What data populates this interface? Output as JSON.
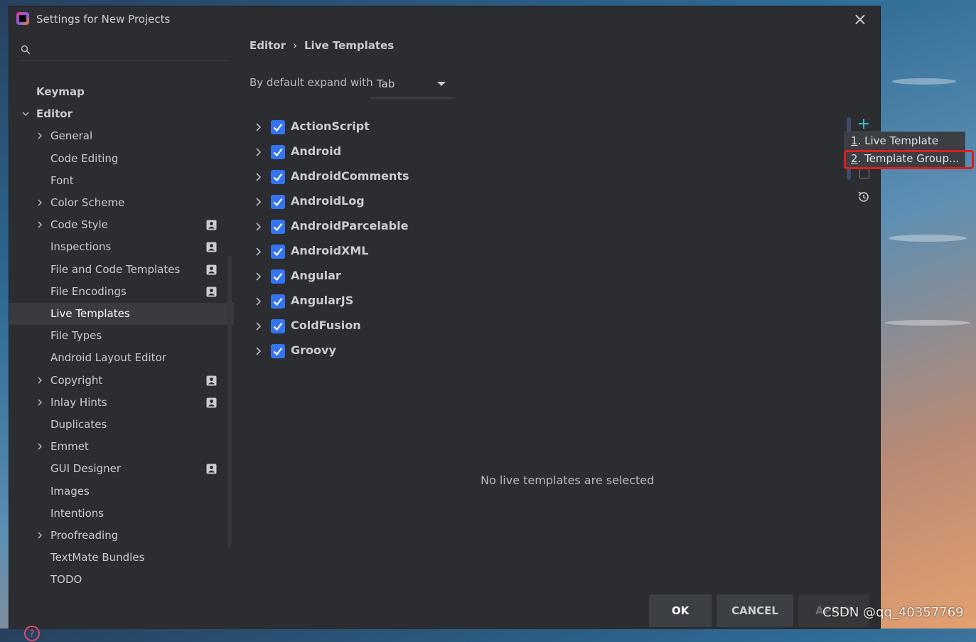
{
  "window": {
    "title": "Settings for New Projects"
  },
  "sidebar": {
    "search_placeholder": "",
    "items": [
      {
        "label": "Keymap",
        "level": 0,
        "expandable": false,
        "chevron": "none",
        "badge": false,
        "selected": false
      },
      {
        "label": "Editor",
        "level": 0,
        "expandable": true,
        "chevron": "down",
        "badge": false,
        "selected": false
      },
      {
        "label": "General",
        "level": 1,
        "expandable": true,
        "chevron": "right",
        "badge": false,
        "selected": false
      },
      {
        "label": "Code Editing",
        "level": 1,
        "expandable": false,
        "chevron": "none",
        "badge": false,
        "selected": false
      },
      {
        "label": "Font",
        "level": 1,
        "expandable": false,
        "chevron": "none",
        "badge": false,
        "selected": false
      },
      {
        "label": "Color Scheme",
        "level": 1,
        "expandable": true,
        "chevron": "right",
        "badge": false,
        "selected": false
      },
      {
        "label": "Code Style",
        "level": 1,
        "expandable": true,
        "chevron": "right",
        "badge": true,
        "selected": false
      },
      {
        "label": "Inspections",
        "level": 1,
        "expandable": false,
        "chevron": "none",
        "badge": true,
        "selected": false
      },
      {
        "label": "File and Code Templates",
        "level": 1,
        "expandable": false,
        "chevron": "none",
        "badge": true,
        "selected": false
      },
      {
        "label": "File Encodings",
        "level": 1,
        "expandable": false,
        "chevron": "none",
        "badge": true,
        "selected": false
      },
      {
        "label": "Live Templates",
        "level": 1,
        "expandable": false,
        "chevron": "none",
        "badge": false,
        "selected": true
      },
      {
        "label": "File Types",
        "level": 1,
        "expandable": false,
        "chevron": "none",
        "badge": false,
        "selected": false
      },
      {
        "label": "Android Layout Editor",
        "level": 1,
        "expandable": false,
        "chevron": "none",
        "badge": false,
        "selected": false
      },
      {
        "label": "Copyright",
        "level": 1,
        "expandable": true,
        "chevron": "right",
        "badge": true,
        "selected": false
      },
      {
        "label": "Inlay Hints",
        "level": 1,
        "expandable": true,
        "chevron": "right",
        "badge": true,
        "selected": false
      },
      {
        "label": "Duplicates",
        "level": 1,
        "expandable": false,
        "chevron": "none",
        "badge": false,
        "selected": false
      },
      {
        "label": "Emmet",
        "level": 1,
        "expandable": true,
        "chevron": "right",
        "badge": false,
        "selected": false
      },
      {
        "label": "GUI Designer",
        "level": 1,
        "expandable": false,
        "chevron": "none",
        "badge": true,
        "selected": false
      },
      {
        "label": "Images",
        "level": 1,
        "expandable": false,
        "chevron": "none",
        "badge": false,
        "selected": false
      },
      {
        "label": "Intentions",
        "level": 1,
        "expandable": false,
        "chevron": "none",
        "badge": false,
        "selected": false
      },
      {
        "label": "Proofreading",
        "level": 1,
        "expandable": true,
        "chevron": "right",
        "badge": false,
        "selected": false
      },
      {
        "label": "TextMate Bundles",
        "level": 1,
        "expandable": false,
        "chevron": "none",
        "badge": false,
        "selected": false
      },
      {
        "label": "TODO",
        "level": 1,
        "expandable": false,
        "chevron": "none",
        "badge": false,
        "selected": false
      }
    ]
  },
  "breadcrumb": {
    "parent": "Editor",
    "separator": "›",
    "current": "Live Templates"
  },
  "expand": {
    "label": "By default expand with",
    "value": "Tab"
  },
  "template_groups": [
    {
      "label": "ActionScript",
      "checked": true
    },
    {
      "label": "Android",
      "checked": true
    },
    {
      "label": "AndroidComments",
      "checked": true
    },
    {
      "label": "AndroidLog",
      "checked": true
    },
    {
      "label": "AndroidParcelable",
      "checked": true
    },
    {
      "label": "AndroidXML",
      "checked": true
    },
    {
      "label": "Angular",
      "checked": true
    },
    {
      "label": "AngularJS",
      "checked": true
    },
    {
      "label": "ColdFusion",
      "checked": true
    },
    {
      "label": "Groovy",
      "checked": true
    }
  ],
  "empty_message": "No live templates are selected",
  "toolbar": {
    "add_icon": "plus-icon",
    "restore_icon": "restore-icon"
  },
  "add_menu": {
    "items": [
      {
        "mnemonic": "1",
        "text": ". Live Template"
      },
      {
        "mnemonic": "2",
        "text": ". Template Group..."
      }
    ]
  },
  "buttons": {
    "ok": "OK",
    "cancel": "CANCEL",
    "apply": "APPLY"
  },
  "watermark": "CSDN @qq_40357769",
  "colors": {
    "accent": "#3574f0",
    "highlight": "#e01d1d",
    "plus": "#3fc3d1"
  }
}
